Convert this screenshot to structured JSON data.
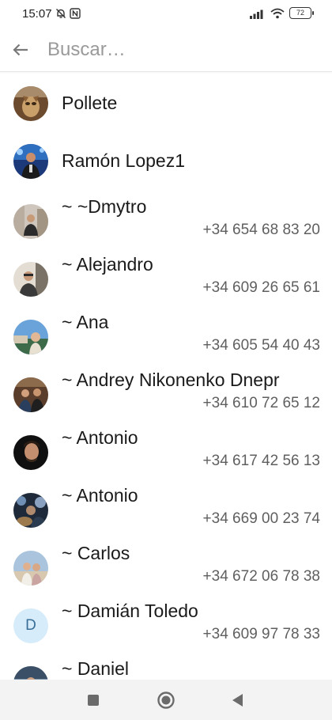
{
  "status_bar": {
    "time": "15:07",
    "battery": "72",
    "icons": [
      "mute-bell-icon",
      "nfc-icon",
      "signal-icon",
      "wifi-icon",
      "battery-icon"
    ]
  },
  "search": {
    "placeholder": "Buscar…",
    "value": ""
  },
  "contacts": [
    {
      "name": "Pollete",
      "phone": ""
    },
    {
      "name": "Ramón Lopez1",
      "phone": ""
    },
    {
      "name": "~ ~Dmytro",
      "phone": "+34 654 68 83 20"
    },
    {
      "name": "~ Alejandro",
      "phone": "+34 609 26 65 61"
    },
    {
      "name": "~ Ana",
      "phone": "+34 605 54 40 43"
    },
    {
      "name": "~ Andrey Nikonenko Dnepr",
      "phone": "+34 610 72 65 12"
    },
    {
      "name": "~ Antonio",
      "phone": "+34 617 42 56 13"
    },
    {
      "name": "~ Antonio",
      "phone": "+34 669 00 23 74"
    },
    {
      "name": "~ Carlos",
      "phone": "+34 672 06 78 38"
    },
    {
      "name": "~ Damián Toledo",
      "phone": "+34 609 97 78 33",
      "initial": "D"
    },
    {
      "name": "~ Daniel",
      "phone": ""
    }
  ],
  "navigation": {
    "buttons": [
      "recents-square-icon",
      "home-circle-icon",
      "back-triangle-icon"
    ]
  },
  "colors": {
    "letter_avatar_bg": "#d6ecfa",
    "letter_avatar_fg": "#3a6f98",
    "placeholder": "#9a9a9a",
    "phone_text": "#5f5f5f"
  }
}
